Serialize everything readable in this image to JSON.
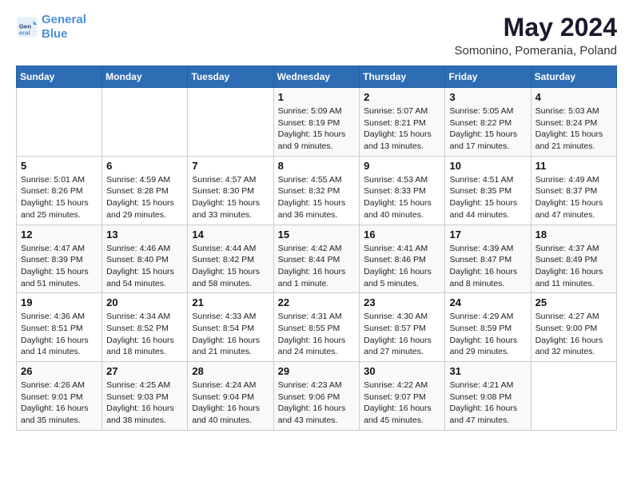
{
  "header": {
    "logo_line1": "General",
    "logo_line2": "Blue",
    "title": "May 2024",
    "subtitle": "Somonino, Pomerania, Poland"
  },
  "weekdays": [
    "Sunday",
    "Monday",
    "Tuesday",
    "Wednesday",
    "Thursday",
    "Friday",
    "Saturday"
  ],
  "weeks": [
    [
      {
        "day": "",
        "sunrise": "",
        "sunset": "",
        "daylight": ""
      },
      {
        "day": "",
        "sunrise": "",
        "sunset": "",
        "daylight": ""
      },
      {
        "day": "",
        "sunrise": "",
        "sunset": "",
        "daylight": ""
      },
      {
        "day": "1",
        "sunrise": "Sunrise: 5:09 AM",
        "sunset": "Sunset: 8:19 PM",
        "daylight": "Daylight: 15 hours and 9 minutes."
      },
      {
        "day": "2",
        "sunrise": "Sunrise: 5:07 AM",
        "sunset": "Sunset: 8:21 PM",
        "daylight": "Daylight: 15 hours and 13 minutes."
      },
      {
        "day": "3",
        "sunrise": "Sunrise: 5:05 AM",
        "sunset": "Sunset: 8:22 PM",
        "daylight": "Daylight: 15 hours and 17 minutes."
      },
      {
        "day": "4",
        "sunrise": "Sunrise: 5:03 AM",
        "sunset": "Sunset: 8:24 PM",
        "daylight": "Daylight: 15 hours and 21 minutes."
      }
    ],
    [
      {
        "day": "5",
        "sunrise": "Sunrise: 5:01 AM",
        "sunset": "Sunset: 8:26 PM",
        "daylight": "Daylight: 15 hours and 25 minutes."
      },
      {
        "day": "6",
        "sunrise": "Sunrise: 4:59 AM",
        "sunset": "Sunset: 8:28 PM",
        "daylight": "Daylight: 15 hours and 29 minutes."
      },
      {
        "day": "7",
        "sunrise": "Sunrise: 4:57 AM",
        "sunset": "Sunset: 8:30 PM",
        "daylight": "Daylight: 15 hours and 33 minutes."
      },
      {
        "day": "8",
        "sunrise": "Sunrise: 4:55 AM",
        "sunset": "Sunset: 8:32 PM",
        "daylight": "Daylight: 15 hours and 36 minutes."
      },
      {
        "day": "9",
        "sunrise": "Sunrise: 4:53 AM",
        "sunset": "Sunset: 8:33 PM",
        "daylight": "Daylight: 15 hours and 40 minutes."
      },
      {
        "day": "10",
        "sunrise": "Sunrise: 4:51 AM",
        "sunset": "Sunset: 8:35 PM",
        "daylight": "Daylight: 15 hours and 44 minutes."
      },
      {
        "day": "11",
        "sunrise": "Sunrise: 4:49 AM",
        "sunset": "Sunset: 8:37 PM",
        "daylight": "Daylight: 15 hours and 47 minutes."
      }
    ],
    [
      {
        "day": "12",
        "sunrise": "Sunrise: 4:47 AM",
        "sunset": "Sunset: 8:39 PM",
        "daylight": "Daylight: 15 hours and 51 minutes."
      },
      {
        "day": "13",
        "sunrise": "Sunrise: 4:46 AM",
        "sunset": "Sunset: 8:40 PM",
        "daylight": "Daylight: 15 hours and 54 minutes."
      },
      {
        "day": "14",
        "sunrise": "Sunrise: 4:44 AM",
        "sunset": "Sunset: 8:42 PM",
        "daylight": "Daylight: 15 hours and 58 minutes."
      },
      {
        "day": "15",
        "sunrise": "Sunrise: 4:42 AM",
        "sunset": "Sunset: 8:44 PM",
        "daylight": "Daylight: 16 hours and 1 minute."
      },
      {
        "day": "16",
        "sunrise": "Sunrise: 4:41 AM",
        "sunset": "Sunset: 8:46 PM",
        "daylight": "Daylight: 16 hours and 5 minutes."
      },
      {
        "day": "17",
        "sunrise": "Sunrise: 4:39 AM",
        "sunset": "Sunset: 8:47 PM",
        "daylight": "Daylight: 16 hours and 8 minutes."
      },
      {
        "day": "18",
        "sunrise": "Sunrise: 4:37 AM",
        "sunset": "Sunset: 8:49 PM",
        "daylight": "Daylight: 16 hours and 11 minutes."
      }
    ],
    [
      {
        "day": "19",
        "sunrise": "Sunrise: 4:36 AM",
        "sunset": "Sunset: 8:51 PM",
        "daylight": "Daylight: 16 hours and 14 minutes."
      },
      {
        "day": "20",
        "sunrise": "Sunrise: 4:34 AM",
        "sunset": "Sunset: 8:52 PM",
        "daylight": "Daylight: 16 hours and 18 minutes."
      },
      {
        "day": "21",
        "sunrise": "Sunrise: 4:33 AM",
        "sunset": "Sunset: 8:54 PM",
        "daylight": "Daylight: 16 hours and 21 minutes."
      },
      {
        "day": "22",
        "sunrise": "Sunrise: 4:31 AM",
        "sunset": "Sunset: 8:55 PM",
        "daylight": "Daylight: 16 hours and 24 minutes."
      },
      {
        "day": "23",
        "sunrise": "Sunrise: 4:30 AM",
        "sunset": "Sunset: 8:57 PM",
        "daylight": "Daylight: 16 hours and 27 minutes."
      },
      {
        "day": "24",
        "sunrise": "Sunrise: 4:29 AM",
        "sunset": "Sunset: 8:59 PM",
        "daylight": "Daylight: 16 hours and 29 minutes."
      },
      {
        "day": "25",
        "sunrise": "Sunrise: 4:27 AM",
        "sunset": "Sunset: 9:00 PM",
        "daylight": "Daylight: 16 hours and 32 minutes."
      }
    ],
    [
      {
        "day": "26",
        "sunrise": "Sunrise: 4:26 AM",
        "sunset": "Sunset: 9:01 PM",
        "daylight": "Daylight: 16 hours and 35 minutes."
      },
      {
        "day": "27",
        "sunrise": "Sunrise: 4:25 AM",
        "sunset": "Sunset: 9:03 PM",
        "daylight": "Daylight: 16 hours and 38 minutes."
      },
      {
        "day": "28",
        "sunrise": "Sunrise: 4:24 AM",
        "sunset": "Sunset: 9:04 PM",
        "daylight": "Daylight: 16 hours and 40 minutes."
      },
      {
        "day": "29",
        "sunrise": "Sunrise: 4:23 AM",
        "sunset": "Sunset: 9:06 PM",
        "daylight": "Daylight: 16 hours and 43 minutes."
      },
      {
        "day": "30",
        "sunrise": "Sunrise: 4:22 AM",
        "sunset": "Sunset: 9:07 PM",
        "daylight": "Daylight: 16 hours and 45 minutes."
      },
      {
        "day": "31",
        "sunrise": "Sunrise: 4:21 AM",
        "sunset": "Sunset: 9:08 PM",
        "daylight": "Daylight: 16 hours and 47 minutes."
      },
      {
        "day": "",
        "sunrise": "",
        "sunset": "",
        "daylight": ""
      }
    ]
  ]
}
